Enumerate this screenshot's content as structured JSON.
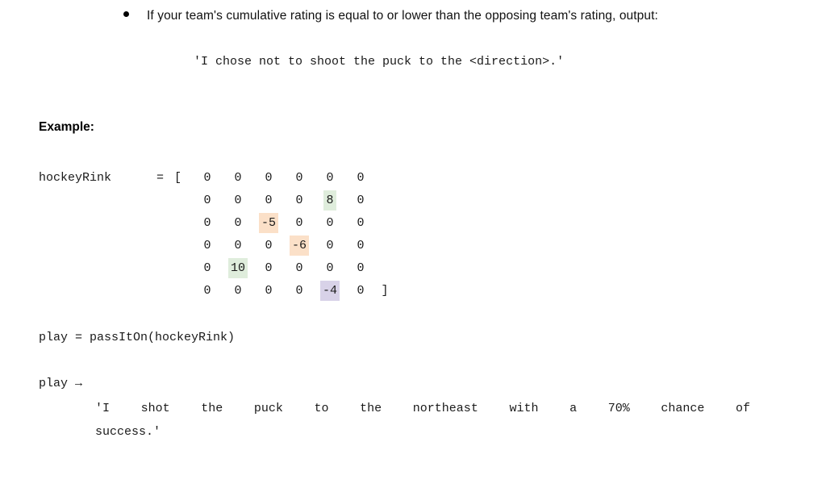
{
  "bullet": {
    "icon": "bullet-dot-icon",
    "text": "If your team's cumulative rating is equal to or lower than the opposing team's rating, output:",
    "quoted_output": "'I chose not to shoot the puck to the <direction>.'"
  },
  "example": {
    "heading": "Example:"
  },
  "matrix": {
    "variable_name": "hockeyRink",
    "equals": "=",
    "open_bracket": "[",
    "close_bracket": "]",
    "rows": [
      [
        "0",
        "0",
        "0",
        "0",
        "0",
        "0"
      ],
      [
        "0",
        "0",
        "0",
        "0",
        "8",
        "0"
      ],
      [
        "0",
        "0",
        "-5",
        "0",
        "0",
        "0"
      ],
      [
        "0",
        "0",
        "0",
        "-6",
        "0",
        "0"
      ],
      [
        "0",
        "10",
        "0",
        "0",
        "0",
        "0"
      ],
      [
        "0",
        "0",
        "0",
        "0",
        "-4",
        "0"
      ]
    ],
    "highlights": [
      {
        "row": 1,
        "col": 4,
        "color": "green"
      },
      {
        "row": 2,
        "col": 2,
        "color": "orange"
      },
      {
        "row": 3,
        "col": 3,
        "color": "orange"
      },
      {
        "row": 4,
        "col": 1,
        "color": "green"
      },
      {
        "row": 5,
        "col": 4,
        "color": "purple"
      }
    ],
    "highlight_colors": {
      "green": "#dfeddc",
      "orange": "#fbe0c8",
      "purple": "#d8d2e8"
    }
  },
  "code": {
    "call_line": "play = passItOn(hockeyRink)",
    "play_line": "play →",
    "output_line_1": "'I shot the puck to the northeast with a 70% chance of",
    "output_line_2": "success.'"
  }
}
